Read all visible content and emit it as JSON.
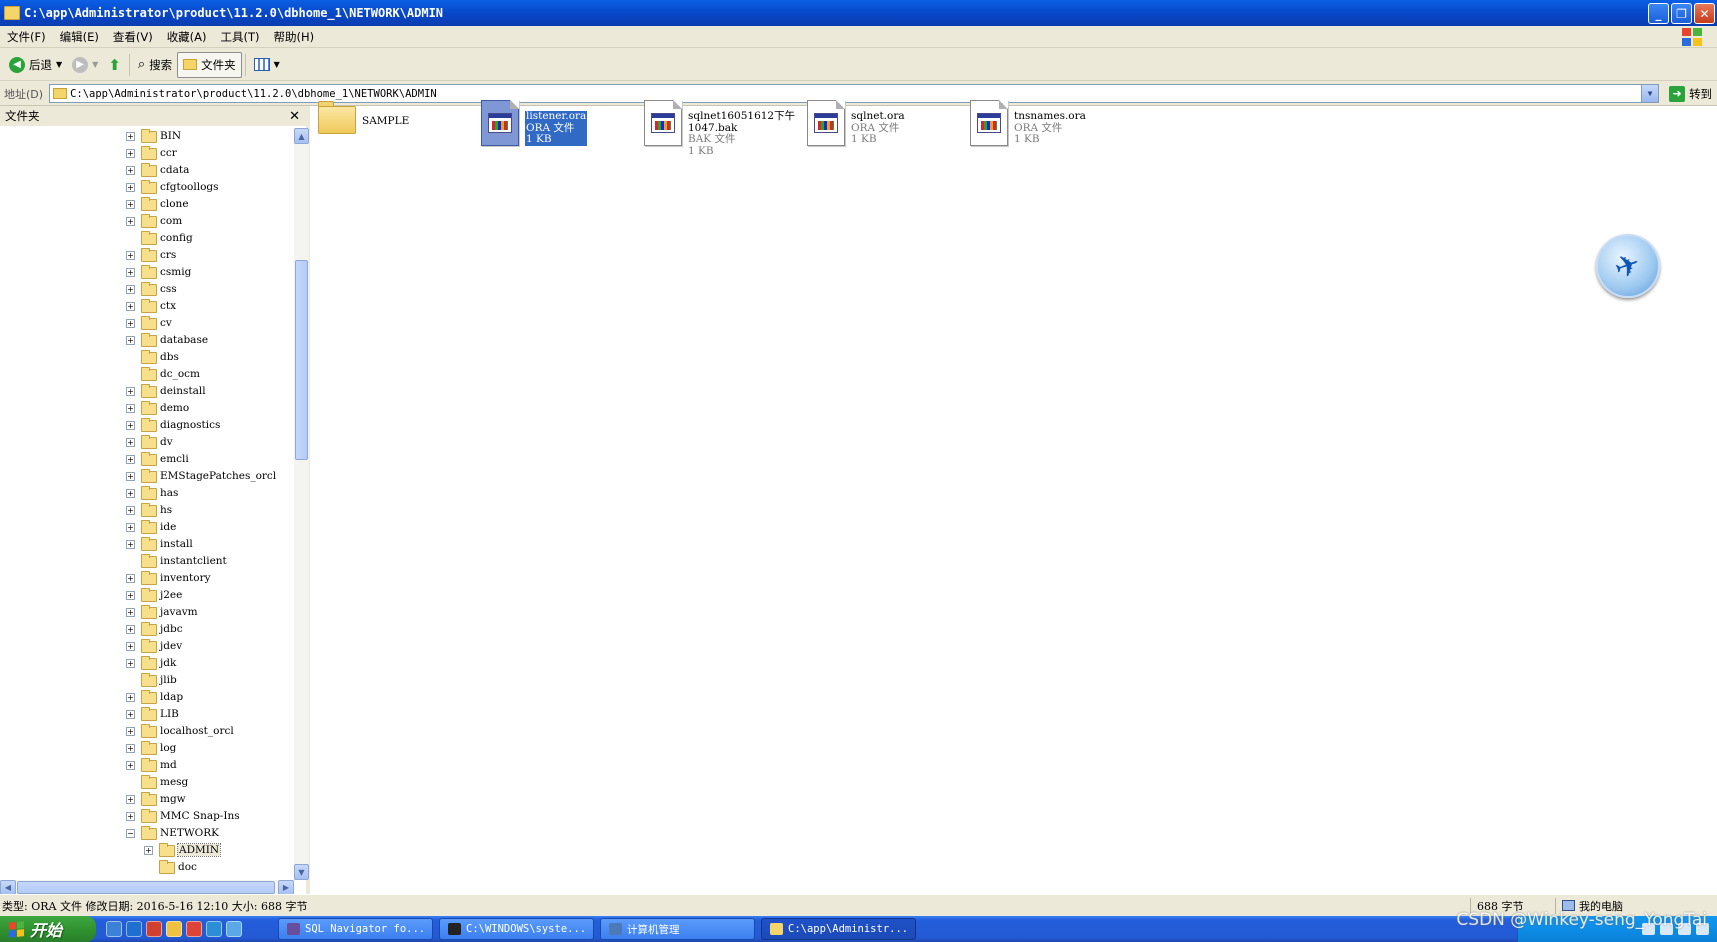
{
  "window": {
    "title": "C:\\app\\Administrator\\product\\11.2.0\\dbhome_1\\NETWORK\\ADMIN",
    "min_glyph": "_",
    "max_glyph": "❐",
    "close_glyph": "✕"
  },
  "menu": [
    "文件(F)",
    "编辑(E)",
    "查看(V)",
    "收藏(A)",
    "工具(T)",
    "帮助(H)"
  ],
  "toolbar": {
    "back_label": "后退",
    "search_label": "搜索",
    "folders_label": "文件夹"
  },
  "address": {
    "label": "地址(D)",
    "value": "C:\\app\\Administrator\\product\\11.2.0\\dbhome_1\\NETWORK\\ADMIN",
    "go_label": "转到"
  },
  "folders_pane": {
    "title": "文件夹",
    "close_glyph": "✕",
    "items": [
      {
        "label": "BIN",
        "expander": "+",
        "level": 0
      },
      {
        "label": "ccr",
        "expander": "+",
        "level": 0
      },
      {
        "label": "cdata",
        "expander": "+",
        "level": 0
      },
      {
        "label": "cfgtoollogs",
        "expander": "+",
        "level": 0
      },
      {
        "label": "clone",
        "expander": "+",
        "level": 0
      },
      {
        "label": "com",
        "expander": "+",
        "level": 0
      },
      {
        "label": "config",
        "expander": "",
        "level": 0
      },
      {
        "label": "crs",
        "expander": "+",
        "level": 0
      },
      {
        "label": "csmig",
        "expander": "+",
        "level": 0
      },
      {
        "label": "css",
        "expander": "+",
        "level": 0
      },
      {
        "label": "ctx",
        "expander": "+",
        "level": 0
      },
      {
        "label": "cv",
        "expander": "+",
        "level": 0
      },
      {
        "label": "database",
        "expander": "+",
        "level": 0
      },
      {
        "label": "dbs",
        "expander": "",
        "level": 0
      },
      {
        "label": "dc_ocm",
        "expander": "",
        "level": 0
      },
      {
        "label": "deinstall",
        "expander": "+",
        "level": 0
      },
      {
        "label": "demo",
        "expander": "+",
        "level": 0
      },
      {
        "label": "diagnostics",
        "expander": "+",
        "level": 0
      },
      {
        "label": "dv",
        "expander": "+",
        "level": 0
      },
      {
        "label": "emcli",
        "expander": "+",
        "level": 0
      },
      {
        "label": "EMStagePatches_orcl",
        "expander": "+",
        "level": 0
      },
      {
        "label": "has",
        "expander": "+",
        "level": 0
      },
      {
        "label": "hs",
        "expander": "+",
        "level": 0
      },
      {
        "label": "ide",
        "expander": "+",
        "level": 0
      },
      {
        "label": "install",
        "expander": "+",
        "level": 0
      },
      {
        "label": "instantclient",
        "expander": "",
        "level": 0
      },
      {
        "label": "inventory",
        "expander": "+",
        "level": 0
      },
      {
        "label": "j2ee",
        "expander": "+",
        "level": 0
      },
      {
        "label": "javavm",
        "expander": "+",
        "level": 0
      },
      {
        "label": "jdbc",
        "expander": "+",
        "level": 0
      },
      {
        "label": "jdev",
        "expander": "+",
        "level": 0
      },
      {
        "label": "jdk",
        "expander": "+",
        "level": 0
      },
      {
        "label": "jlib",
        "expander": "",
        "level": 0
      },
      {
        "label": "ldap",
        "expander": "+",
        "level": 0
      },
      {
        "label": "LIB",
        "expander": "+",
        "level": 0
      },
      {
        "label": "localhost_orcl",
        "expander": "+",
        "level": 0
      },
      {
        "label": "log",
        "expander": "+",
        "level": 0
      },
      {
        "label": "md",
        "expander": "+",
        "level": 0
      },
      {
        "label": "mesg",
        "expander": "",
        "level": 0
      },
      {
        "label": "mgw",
        "expander": "+",
        "level": 0
      },
      {
        "label": "MMC Snap-Ins",
        "expander": "+",
        "level": 0
      },
      {
        "label": "NETWORK",
        "expander": "−",
        "level": 0
      },
      {
        "label": "ADMIN",
        "expander": "+",
        "level": 1,
        "selected": true
      },
      {
        "label": "doc",
        "expander": "",
        "level": 1
      }
    ]
  },
  "files": [
    {
      "kind": "folder",
      "name": "SAMPLE",
      "type": "",
      "size": ""
    },
    {
      "kind": "file",
      "name": "listener.ora",
      "type": "ORA 文件",
      "size": "1 KB",
      "selected": true
    },
    {
      "kind": "file",
      "name": "sqlnet16051612下午1047.bak",
      "type": "BAK 文件",
      "size": "1 KB"
    },
    {
      "kind": "file",
      "name": "sqlnet.ora",
      "type": "ORA 文件",
      "size": "1 KB"
    },
    {
      "kind": "file",
      "name": "tnsnames.ora",
      "type": "ORA 文件",
      "size": "1 KB"
    }
  ],
  "status": {
    "details": "类型: ORA 文件 修改日期: 2016-5-16 12:10 大小: 688 字节",
    "size": "688 字节",
    "zone": "我的电脑"
  },
  "taskbar": {
    "start_label": "开始",
    "tasks": [
      {
        "label": "SQL Navigator fo...",
        "color": "#6A4E9E"
      },
      {
        "label": "C:\\WINDOWS\\syste...",
        "color": "#222222"
      },
      {
        "label": "计算机管理",
        "color": "#4C7AB8"
      },
      {
        "label": "C:\\app\\Administr...",
        "color": "#F5D56A",
        "active": true
      }
    ]
  },
  "watermark": "CSDN @Winkey-seng_YongTai",
  "colors": {
    "titlebar": "#0846C6",
    "selection": "#316AC5",
    "taskbar": "#245EDB",
    "start": "#2E8F2E"
  }
}
